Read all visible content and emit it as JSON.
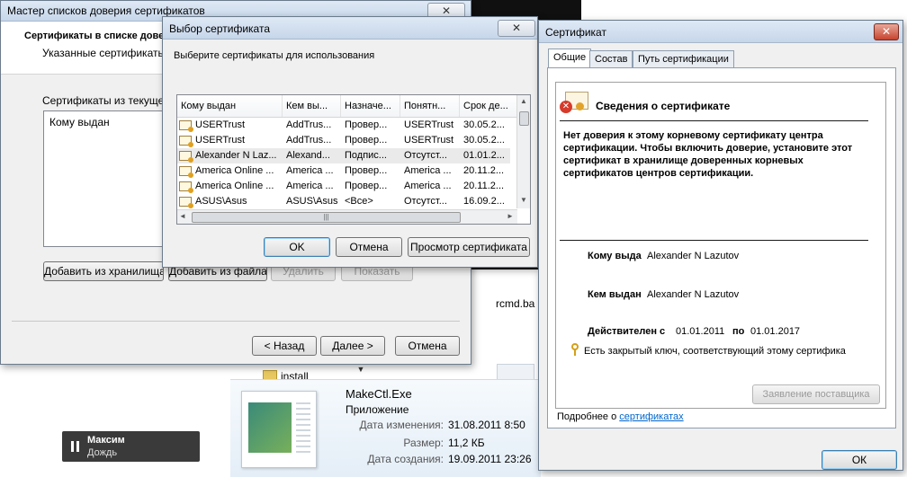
{
  "background": {
    "rcmd_label": "rcmd.ba",
    "folder_label": "install",
    "file": {
      "name": "MakeCtl.Exe",
      "type": "Приложение",
      "modified_label": "Дата изменения:",
      "modified_value": "31.08.2011 8:50",
      "size_label": "Размер:",
      "size_value": "11,2 КБ",
      "created_label": "Дата создания:",
      "created_value": "19.09.2011 23:26"
    },
    "player": {
      "artist": "Максим",
      "track": "Дождь"
    }
  },
  "wizard": {
    "title": "Мастер списков доверия сертификатов",
    "heading": "Сертификаты в списке довери",
    "subheading": "Указанные сертификаты",
    "list_label": "Сертификаты из текущег",
    "list_column": "Кому выдан",
    "buttons": {
      "add_store": "Добавить из хранилища",
      "add_file": "Добавить из файла",
      "remove": "Удалить",
      "view": "Показать",
      "back": "< Назад",
      "next": "Далее >",
      "cancel": "Отмена"
    }
  },
  "select_dialog": {
    "title": "Выбор сертификата",
    "instruction": "Выберите сертификаты для использования",
    "columns": [
      "Кому выдан",
      "Кем вы...",
      "Назначе...",
      "Понятн...",
      "Срок де..."
    ],
    "rows": [
      [
        "USERTrust",
        "AddTrus...",
        "Провер...",
        "USERTrust",
        "30.05.2..."
      ],
      [
        "USERTrust",
        "AddTrus...",
        "Провер...",
        "USERTrust",
        "30.05.2..."
      ],
      [
        "Alexander N Laz...",
        "Alexand...",
        "Подпис...",
        "Отсутст...",
        "01.01.2..."
      ],
      [
        "America Online ...",
        "America ...",
        "Провер...",
        "America ...",
        "20.11.2..."
      ],
      [
        "America Online ...",
        "America ...",
        "Провер...",
        "America ...",
        "20.11.2..."
      ],
      [
        "ASUS\\Asus",
        "ASUS\\Asus",
        "<Все>",
        "Отсутст...",
        "16.09.2..."
      ]
    ],
    "buttons": {
      "ok": "OK",
      "cancel": "Отмена",
      "view": "Просмотр сертификата"
    }
  },
  "cert_window": {
    "title": "Сертификат",
    "tabs": [
      "Общие",
      "Состав",
      "Путь сертификации"
    ],
    "info_title": "Сведения о сертификате",
    "warning": "Нет доверия к этому корневому сертификату центра сертификации. Чтобы включить  доверие, установите этот сертификат в хранилище доверенных корневых сертификатов центров сертификации.",
    "issued_to_label": "Кому выда",
    "issued_to_value": "Alexander N Lazutov",
    "issued_by_label": "Кем выдан",
    "issued_by_value": "Alexander N Lazutov",
    "valid_from_label": "Действителен с",
    "valid_from_value": "01.01.2011",
    "valid_to_label": "по",
    "valid_to_value": "01.01.2017",
    "private_key_note": "Есть закрытый ключ, соответствующий этому сертифика",
    "issuer_statement_button": "Заявление поставщика",
    "more_info_prefix": "Подробнее о",
    "more_info_link": "сертификатах",
    "ok_button": "ОК"
  }
}
